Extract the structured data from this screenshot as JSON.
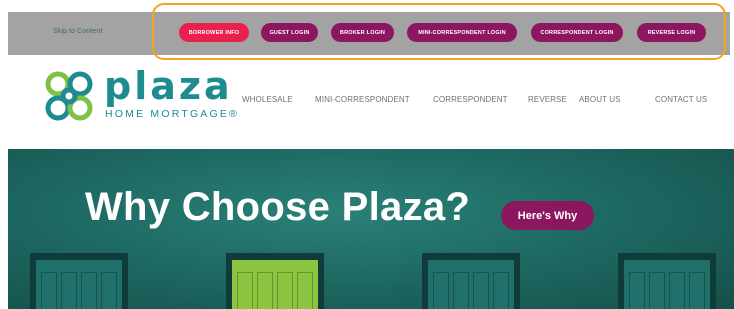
{
  "top_bar": {
    "skip_link": "Skip to Content",
    "buttons": [
      {
        "label": "BORROWER INFO",
        "active": true
      },
      {
        "label": "GUEST LOGIN",
        "active": false
      },
      {
        "label": "BROKER LOGIN",
        "active": false
      },
      {
        "label": "MINI-CORRESPONDENT LOGIN",
        "active": false
      },
      {
        "label": "CORRESPONDENT LOGIN",
        "active": false
      },
      {
        "label": "REVERSE LOGIN",
        "active": false
      }
    ]
  },
  "logo": {
    "word": "plaza",
    "sub": "HOME MORTGAGE®"
  },
  "nav": {
    "items": [
      "WHOLESALE",
      "MINI-CORRESPONDENT",
      "CORRESPONDENT",
      "REVERSE",
      "ABOUT US",
      "CONTACT US"
    ]
  },
  "hero": {
    "title": "Why Choose Plaza?",
    "cta": "Here's Why"
  },
  "colors": {
    "brand_teal": "#1d8b8f",
    "brand_green": "#7dc242",
    "button_purple": "#8c1660",
    "button_red": "#e8214f",
    "highlight_orange": "#f2a41c",
    "door_green": "#8bc53f"
  }
}
